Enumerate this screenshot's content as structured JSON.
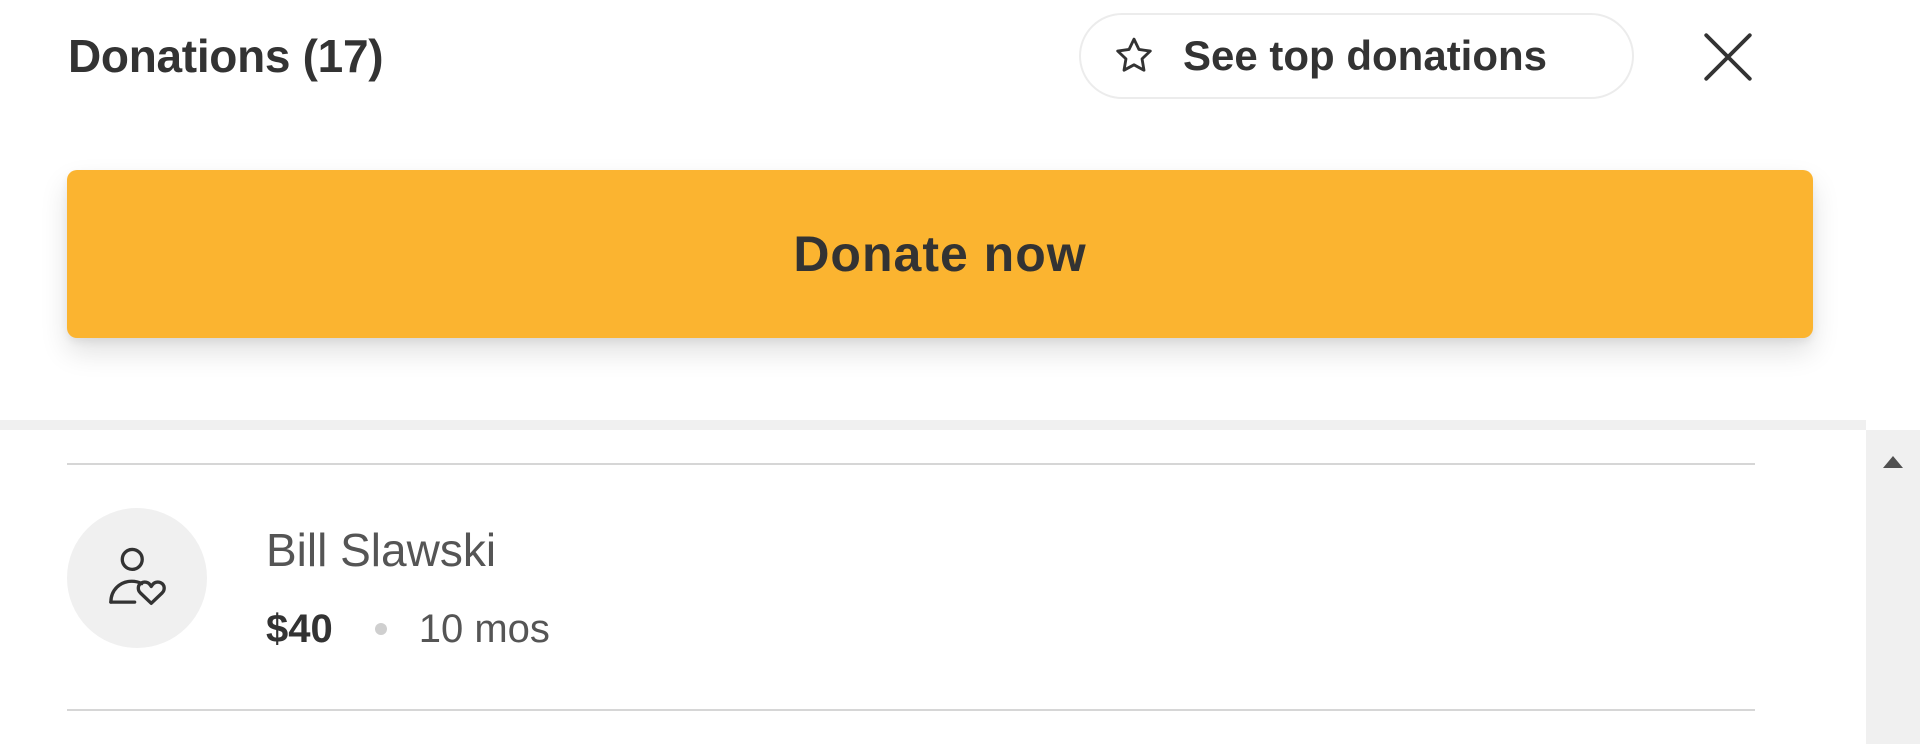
{
  "header": {
    "title": "Donations (17)",
    "top_donations_label": "See top donations",
    "top_donations_icon": "star-outline-icon",
    "close_icon": "close-icon"
  },
  "donate_button": {
    "label": "Donate now",
    "color": "#fbb430"
  },
  "donations": [
    {
      "name": "Bill Slawski",
      "amount": "$40",
      "time": "10 mos",
      "avatar_icon": "person-heart-icon"
    }
  ],
  "scrollbar": {
    "up_icon": "scroll-up-arrow-icon"
  }
}
